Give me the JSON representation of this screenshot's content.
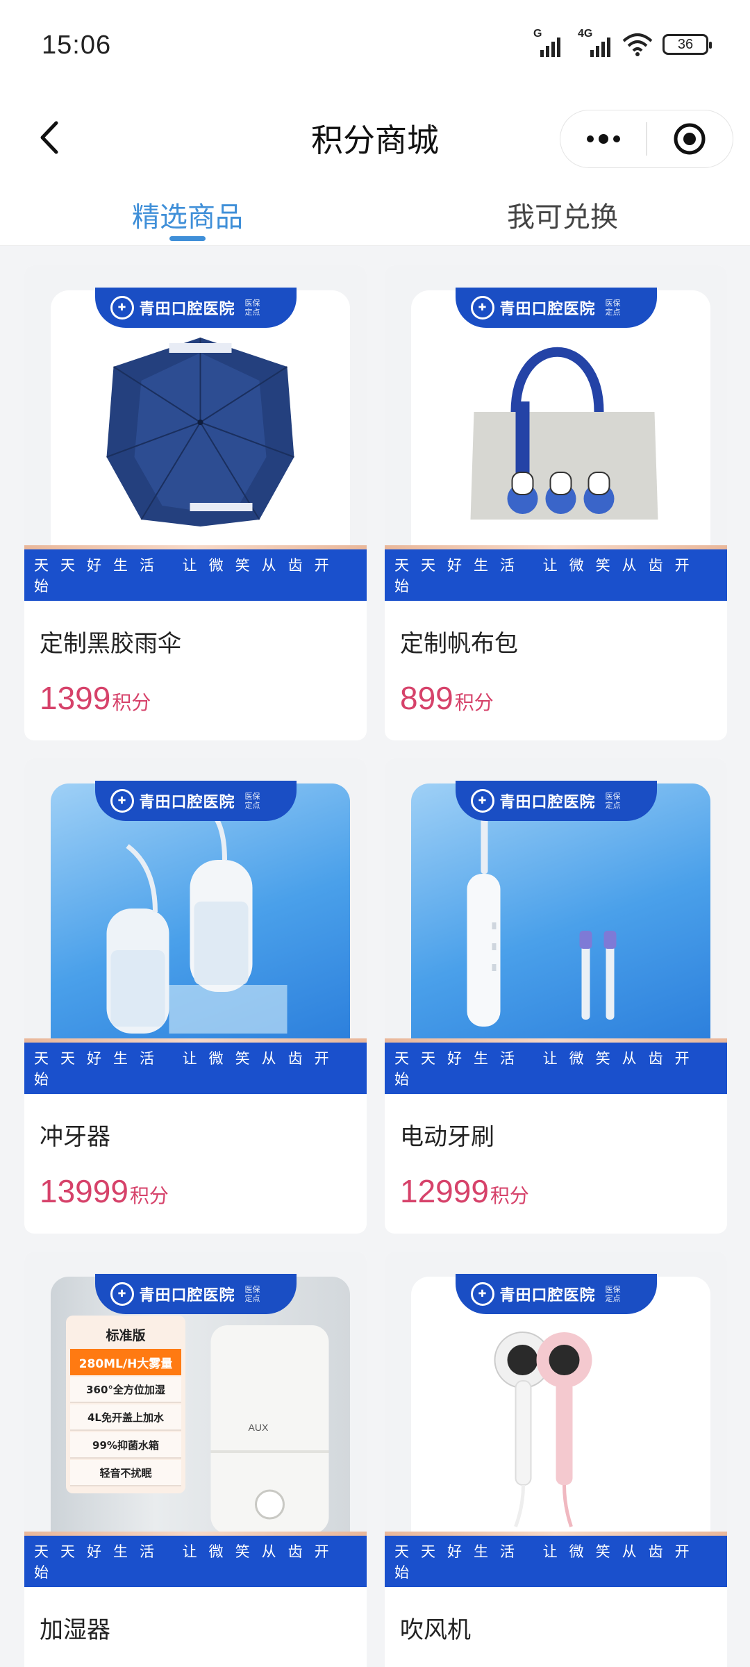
{
  "status": {
    "time": "15:06",
    "sig1": "G",
    "sig2": "4G",
    "battery": "36"
  },
  "nav": {
    "title": "积分商城"
  },
  "tabs": [
    {
      "label": "精选商品"
    },
    {
      "label": "我可兑换"
    }
  ],
  "brand": {
    "name": "青田口腔医院",
    "tag1": "医保",
    "tag2": "定点"
  },
  "slogan": "天天好生活 让微笑从齿开始",
  "humidifier_features": {
    "header": "标准版",
    "highlight": "280ML/H大雾量",
    "items": [
      "360°全方位加湿",
      "4L免开盖上加水",
      "99%抑菌水箱",
      "轻音不扰眠"
    ],
    "logo": "AUX"
  },
  "products": [
    {
      "name": "定制黑胶雨伞",
      "points": "1399",
      "unit": "积分"
    },
    {
      "name": "定制帆布包",
      "points": "899",
      "unit": "积分"
    },
    {
      "name": "冲牙器",
      "points": "13999",
      "unit": "积分"
    },
    {
      "name": "电动牙刷",
      "points": "12999",
      "unit": "积分"
    },
    {
      "name": "加湿器",
      "points": "",
      "unit": ""
    },
    {
      "name": "吹风机",
      "points": "",
      "unit": ""
    }
  ]
}
